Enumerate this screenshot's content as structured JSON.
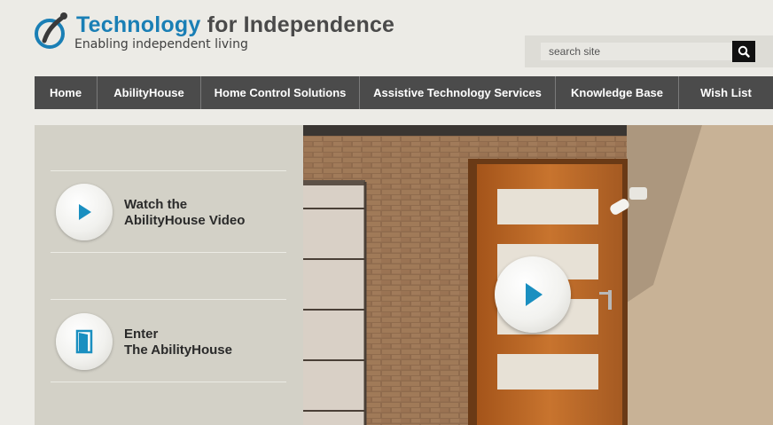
{
  "logo": {
    "title_part1": "Technology",
    "title_part2": "for Independence",
    "tagline": "Enabling independent living"
  },
  "search": {
    "placeholder": "search site",
    "button_icon": "search-icon"
  },
  "nav": {
    "items": [
      {
        "label": "Home"
      },
      {
        "label": "AbilityHouse"
      },
      {
        "label": "Home Control Solutions"
      },
      {
        "label": "Assistive Technology Services"
      },
      {
        "label": "Knowledge Base"
      },
      {
        "label": "Wish List"
      }
    ]
  },
  "panel": {
    "video_line1": "Watch the",
    "video_line2": "AbilityHouse Video",
    "enter_line1": "Enter",
    "enter_line2": "The AbilityHouse"
  },
  "hero": {
    "play_icon": "play-icon"
  },
  "colors": {
    "brand_blue": "#1a7fb5",
    "nav_bg": "#4b4b4b",
    "panel_bg": "#d3d1c7",
    "icon_teal": "#1a8fc0"
  }
}
